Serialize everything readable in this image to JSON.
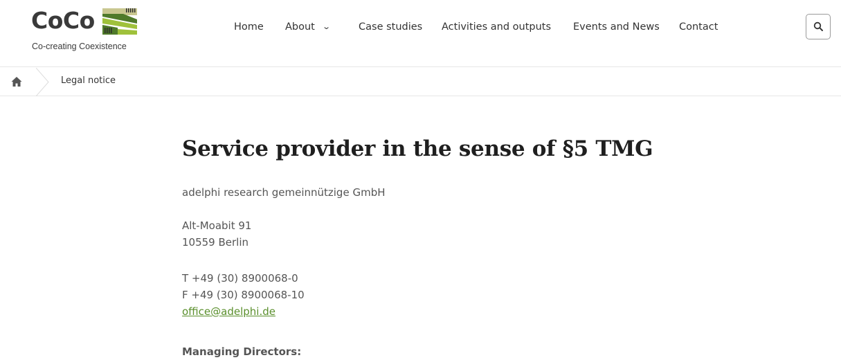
{
  "brand": {
    "name": "CoCo",
    "tagline": "Co-creating Coexistence",
    "colors": {
      "green_light": "#9fc13b",
      "green_dark": "#4f7a2a",
      "olive": "#c9c790",
      "link": "#5a8f2c"
    }
  },
  "nav": {
    "items": [
      {
        "label": "Home"
      },
      {
        "label": "About",
        "has_dropdown": true
      },
      {
        "label": "Case studies"
      },
      {
        "label": "Activities and outputs"
      },
      {
        "label": "Events and News"
      },
      {
        "label": "Contact"
      }
    ],
    "search_icon": "search-icon"
  },
  "breadcrumb": {
    "home_icon": "home-icon",
    "current": "Legal notice"
  },
  "main": {
    "title": "Service provider in the sense of §5 TMG",
    "company": "adelphi research gemeinnützige GmbH",
    "address": [
      "Alt-Moabit 91",
      "10559 Berlin"
    ],
    "contact": {
      "phone": "T +49 (30) 8900068-0",
      "fax": "F +49 (30) 8900068-10",
      "email": "office@adelphi.de"
    },
    "managing_directors_label": "Managing Directors:"
  }
}
